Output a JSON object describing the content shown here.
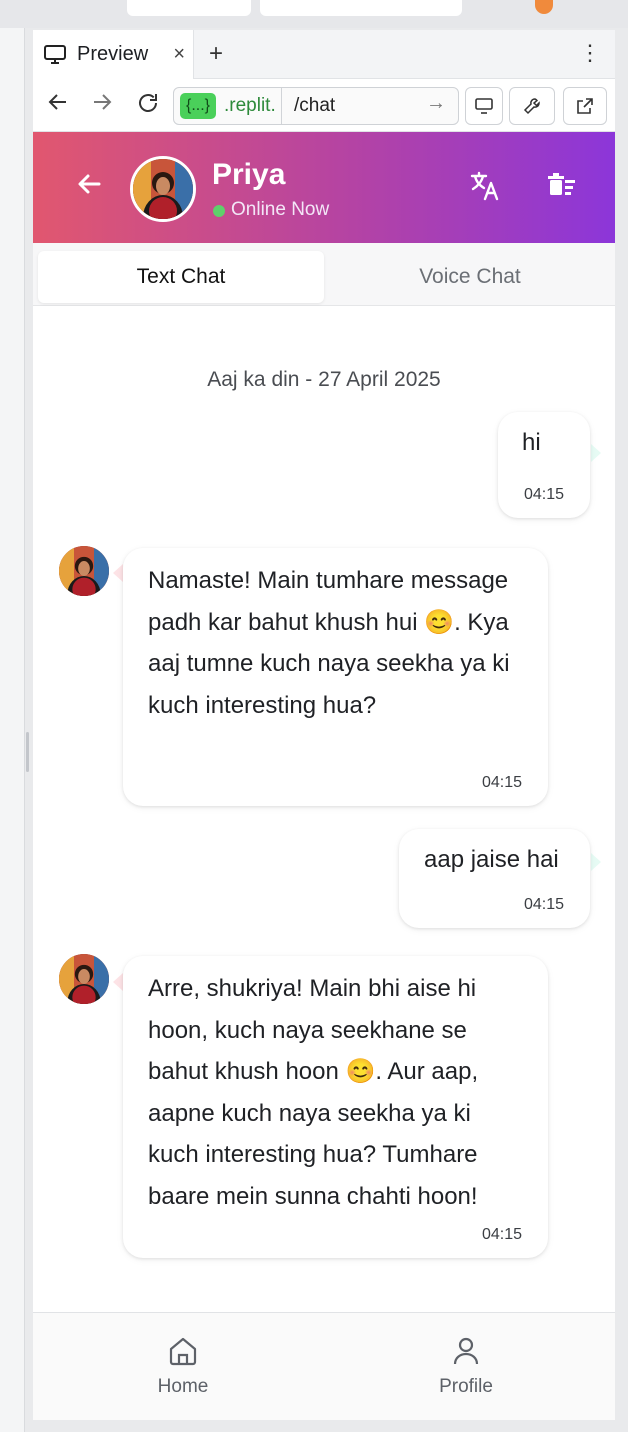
{
  "browser": {
    "tab_title": "Preview",
    "tab_close": "×",
    "new_tab": "+",
    "menu": "⋮",
    "url_domain_chip": "{...}",
    "url_domain": ".replit.",
    "url_path": "/chat"
  },
  "chat_header": {
    "contact_name": "Priya",
    "status": "Online Now"
  },
  "mode_tabs": {
    "text": "Text Chat",
    "voice": "Voice Chat"
  },
  "conversation": {
    "date_label": "Aaj ka din - 27 April 2025",
    "messages": [
      {
        "sender": "user",
        "text": "hi",
        "time": "04:15"
      },
      {
        "sender": "bot",
        "text": "Namaste! Main tumhare message padh kar bahut khush hui 😊. Kya aaj tumne kuch naya seekha ya ki kuch interesting hua?",
        "time": "04:15"
      },
      {
        "sender": "user",
        "text": "aap jaise hai",
        "time": "04:15"
      },
      {
        "sender": "bot",
        "text": "Arre, shukriya! Main bhi aise hi hoon, kuch naya seekhane se bahut khush hoon 😊. Aur aap, aapne kuch naya seekha ya ki kuch interesting hua? Tumhare baare mein sunna chahti hoon!",
        "time": "04:15"
      }
    ]
  },
  "bottom_nav": {
    "home": "Home",
    "profile": "Profile"
  },
  "colors": {
    "header_gradient_start": "#e1576f",
    "header_gradient_end": "#8c36d9",
    "online_dot": "#5fd06b"
  },
  "icons": {
    "tab": "monitor-icon",
    "back": "arrow-left-icon",
    "forward": "arrow-right-icon",
    "reload": "reload-icon",
    "devices": "monitor-icon",
    "devtools": "wrench-icon",
    "open_external": "external-link-icon",
    "translate": "translate-icon",
    "clear_chat": "delete-sweep-icon",
    "home": "home-icon",
    "profile": "user-icon"
  }
}
